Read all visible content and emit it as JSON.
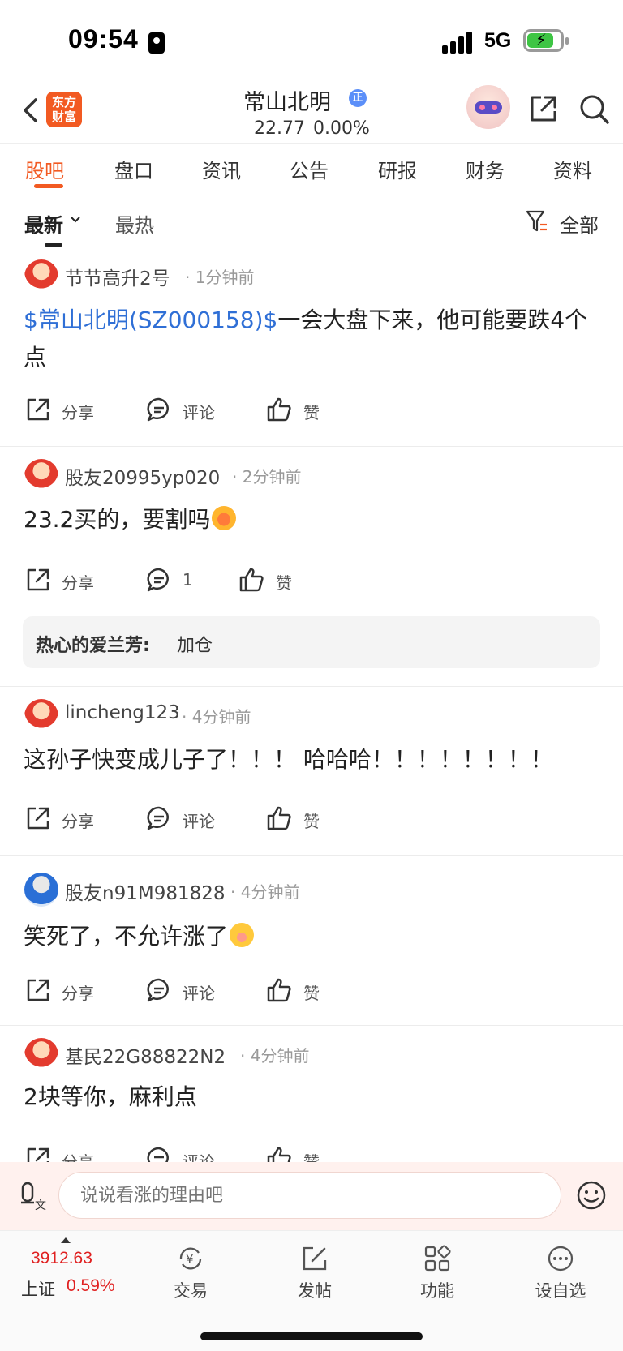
{
  "status_bar": {
    "time": "09:54",
    "network": "5G"
  },
  "header": {
    "logo_text": "东方财富",
    "stock_name": "常山北明",
    "verify_badge": "正",
    "price": "22.77",
    "change": "0.00%"
  },
  "tabs": [
    "股吧",
    "盘口",
    "资讯",
    "公告",
    "研报",
    "财务",
    "资料"
  ],
  "sort": {
    "latest": "最新",
    "hot": "最热",
    "filter": "全部"
  },
  "posts": [
    {
      "user": "节节高升2号",
      "time": "· 1分钟前",
      "mention": "$常山北明(SZ000158)$",
      "text": "一会大盘下来，他可能要跌4个点",
      "share": "分享",
      "comment": "评论",
      "like": "赞"
    },
    {
      "user": "股友20995yp020",
      "time": "· 2分钟前",
      "text": "23.2买的，要割吗",
      "share": "分享",
      "comment": "1",
      "like": "赞",
      "reply": {
        "author": "热心的爱兰芳:",
        "text": "加仓"
      }
    },
    {
      "user": "lincheng123",
      "time": "· 4分钟前",
      "text": "这孙子快变成儿子了！！！ 哈哈哈！！！！！！！！",
      "share": "分享",
      "comment": "评论",
      "like": "赞"
    },
    {
      "user": "股友n91M981828",
      "time": "· 4分钟前",
      "text": "笑死了，不允许涨了",
      "share": "分享",
      "comment": "评论",
      "like": "赞"
    },
    {
      "user": "基民22G88822N2",
      "time": "· 4分钟前",
      "text": "2块等你，麻利点",
      "share": "分享",
      "comment": "评论",
      "like": "赞"
    }
  ],
  "comment_bar": {
    "placeholder": "说说看涨的理由吧"
  },
  "bottom_nav": {
    "index_value": "3912.63",
    "index_name": "上证",
    "index_change": "0.59%",
    "items": [
      "交易",
      "发帖",
      "功能",
      "设自选"
    ]
  }
}
